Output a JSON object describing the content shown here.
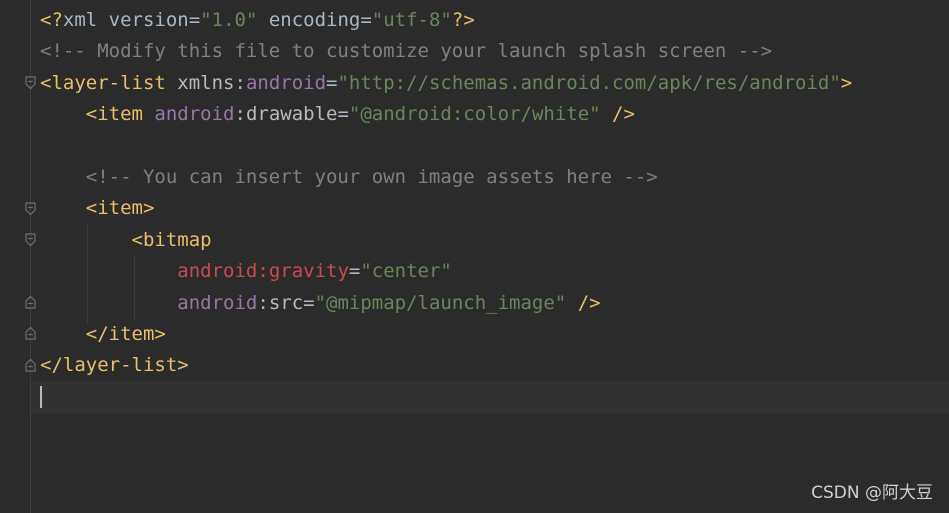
{
  "editor": {
    "language": "xml",
    "colors": {
      "background": "#2b2b2b",
      "tag": "#e8bf6a",
      "attribute": "#bababa",
      "namespace": "#9876aa",
      "namespace_highlight": "#cc4b4b",
      "string": "#6a8759",
      "comment": "#808080"
    },
    "lines": {
      "l1": {
        "open": "<?",
        "name": "xml",
        "attr1": " version",
        "eq1": "=",
        "val1": "\"1.0\"",
        "attr2": " encoding",
        "eq2": "=",
        "val2": "\"utf-8\"",
        "close": "?>"
      },
      "l2": {
        "comment": "<!-- Modify this file to customize your launch splash screen -->"
      },
      "l3": {
        "open": "<layer-list",
        "attr": " xmlns",
        "colon": ":",
        "ns": "android",
        "eq": "=",
        "val": "\"http://schemas.android.com/apk/res/android\"",
        "close": ">"
      },
      "l4": {
        "open": "<item",
        "ns": "android",
        "colon": ":",
        "attr": "drawable",
        "eq": "=",
        "val": "\"@android:color/white\"",
        "close": "/>"
      },
      "l6": {
        "comment": "<!-- You can insert your own image assets here -->"
      },
      "l7": {
        "tag": "<item>"
      },
      "l8": {
        "open": "<bitmap"
      },
      "l9": {
        "ns": "android",
        "colon": ":",
        "attr": "gravity",
        "eq": "=",
        "val": "\"center\""
      },
      "l10": {
        "ns": "android",
        "colon": ":",
        "attr": "src",
        "eq": "=",
        "val": "\"@mipmap/launch_image\"",
        "close": "/>"
      },
      "l11": {
        "tag": "</item>"
      },
      "l12": {
        "tag": "</layer-list>"
      }
    }
  },
  "watermark": {
    "text": "CSDN @阿大豆"
  }
}
